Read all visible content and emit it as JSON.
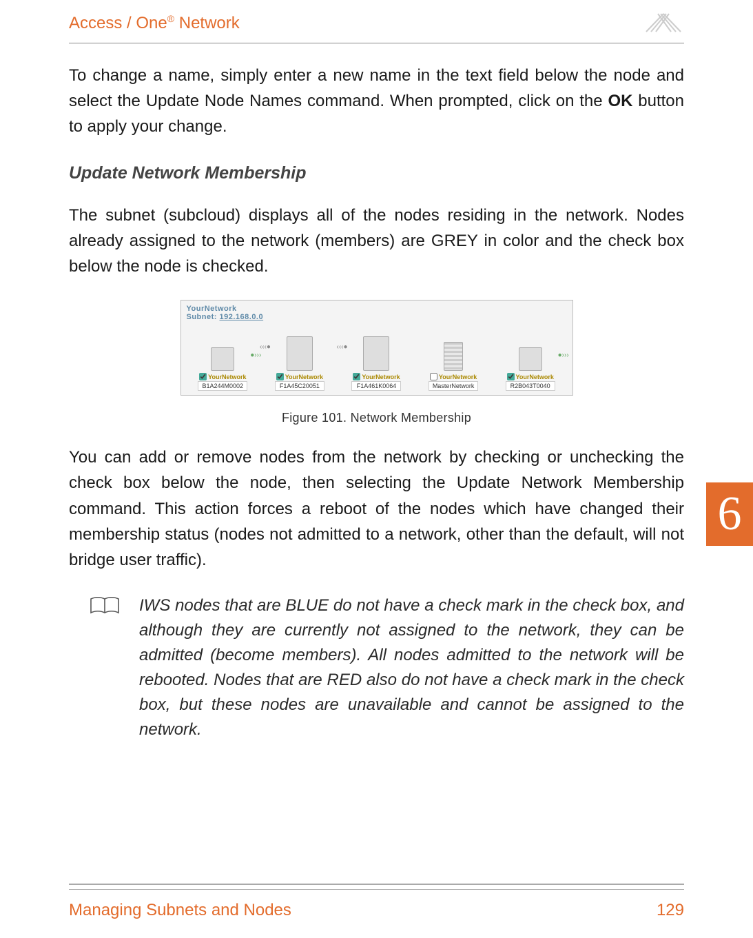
{
  "header": {
    "title_pre": "Access / One",
    "title_sup": "®",
    "title_post": " Network"
  },
  "p1": {
    "pre": "To change a name, simply enter a new name in the text field below the node and select the Update Node Names command. When prompted, click on the ",
    "bold": "OK",
    "post": " button to apply your change."
  },
  "h2": "Update Network Membership",
  "p2": "The subnet (subcloud) displays all of the nodes residing in the network. Nodes already assigned to the network (members) are GREY in color and the check box below the node is checked.",
  "figure": {
    "network_name": "YourNetwork",
    "subnet_label": "Subnet: ",
    "subnet_value": "192.168.0.0",
    "nodes": [
      {
        "id": "B1A244M0002",
        "check_label": "YourNetwork",
        "checked": true
      },
      {
        "id": "F1A45C20051",
        "check_label": "YourNetwork",
        "checked": true
      },
      {
        "id": "F1A461K0064",
        "check_label": "YourNetwork",
        "checked": true
      },
      {
        "id": "MasterNetwork",
        "check_label": "YourNetwork",
        "checked": false
      },
      {
        "id": "R2B043T0040",
        "check_label": "YourNetwork",
        "checked": true
      }
    ],
    "caption": "Figure 101. Network Membership"
  },
  "p3": "You can add or remove nodes from the network by checking or unchecking the check box below the node, then selecting the Update Network Membership command. This action forces a reboot of the nodes which have changed their membership status (nodes not admitted to a network, other than the default, will not bridge user traffic).",
  "note": "IWS nodes that are BLUE do not have a check mark in the check box, and although they are currently not assigned to the network, they can be admitted (become members). All nodes admitted to the network will be rebooted. Nodes that are RED also do not have a check mark in the check box, but these nodes are unavailable and cannot be assigned to the network.",
  "side_tab": "6",
  "footer": {
    "section": "Managing Subnets and Nodes",
    "page": "129"
  }
}
